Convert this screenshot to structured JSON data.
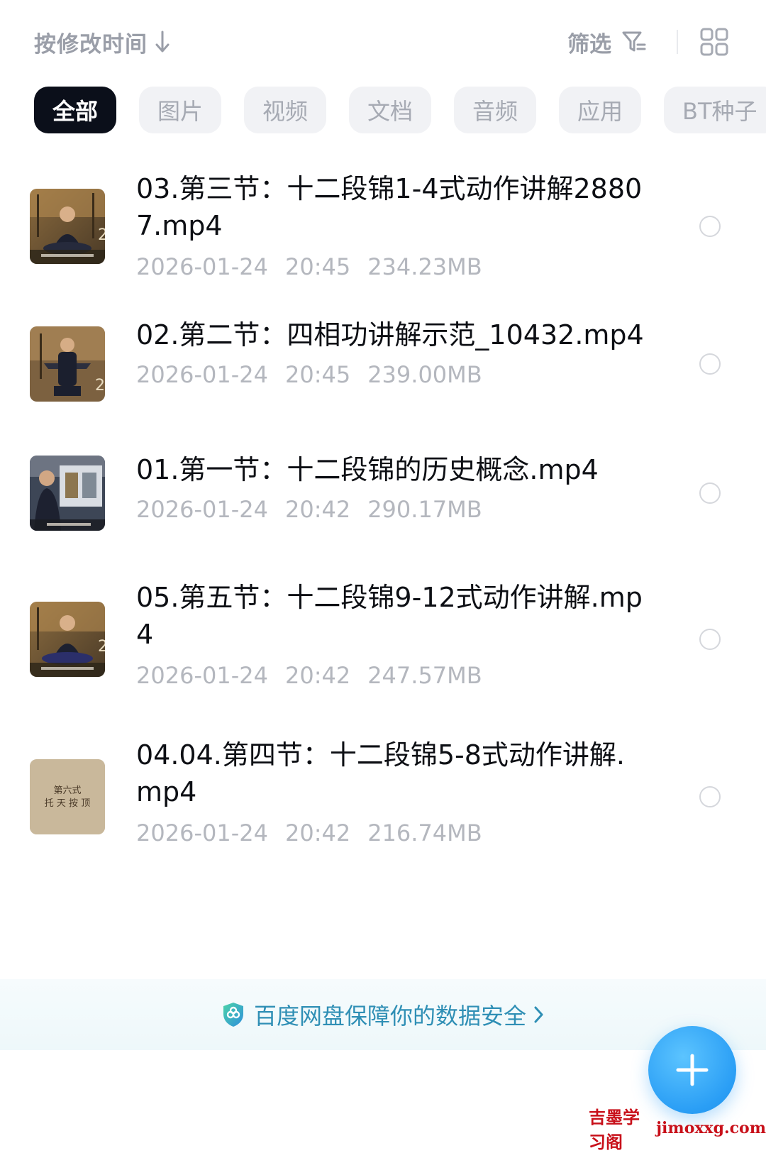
{
  "toolbar": {
    "sort_label": "按修改时间",
    "sort_icon": "arrow-down-icon",
    "filter_label": "筛选",
    "filter_icon": "filter-icon",
    "view_icon": "grid-view-icon"
  },
  "tabs": [
    {
      "label": "全部",
      "active": true
    },
    {
      "label": "图片",
      "active": false
    },
    {
      "label": "视频",
      "active": false
    },
    {
      "label": "文档",
      "active": false
    },
    {
      "label": "音频",
      "active": false
    },
    {
      "label": "应用",
      "active": false
    },
    {
      "label": "BT种子",
      "active": false
    }
  ],
  "files": [
    {
      "name": "03.第三节：十二段锦1-4式动作讲解28807.mp4",
      "date": "2026-01-24",
      "time": "20:45",
      "size": "234.23MB",
      "thumb": "video-thumbnail-seated-man"
    },
    {
      "name": "02.第二节：四相功讲解示范_10432.mp4",
      "date": "2026-01-24",
      "time": "20:45",
      "size": "239.00MB",
      "thumb": "video-thumbnail-standing-man"
    },
    {
      "name": "01.第一节：十二段锦的历史概念.mp4",
      "date": "2026-01-24",
      "time": "20:42",
      "size": "290.17MB",
      "thumb": "video-thumbnail-lecture"
    },
    {
      "name": "05.第五节：十二段锦9-12式动作讲解.mp4",
      "date": "2026-01-24",
      "time": "20:42",
      "size": "247.57MB",
      "thumb": "video-thumbnail-seated-man"
    },
    {
      "name": "04.04.第四节：十二段锦5-8式动作讲解.mp4",
      "date": "2026-01-24",
      "time": "20:42",
      "size": "216.74MB",
      "thumb": "video-thumbnail-title-card"
    }
  ],
  "thumb_captions": {
    "title_card_line1": "第六式",
    "title_card_line2": "托 天 按 顶"
  },
  "security_banner": {
    "text": "百度网盘保障你的数据安全",
    "icon": "shield-icon",
    "accent": "#2f8fb5"
  },
  "fab": {
    "icon": "plus-icon",
    "color": "#2a9ef5"
  },
  "watermark": {
    "cn": "吉墨学习阁",
    "en": "jimoxxg.com"
  }
}
